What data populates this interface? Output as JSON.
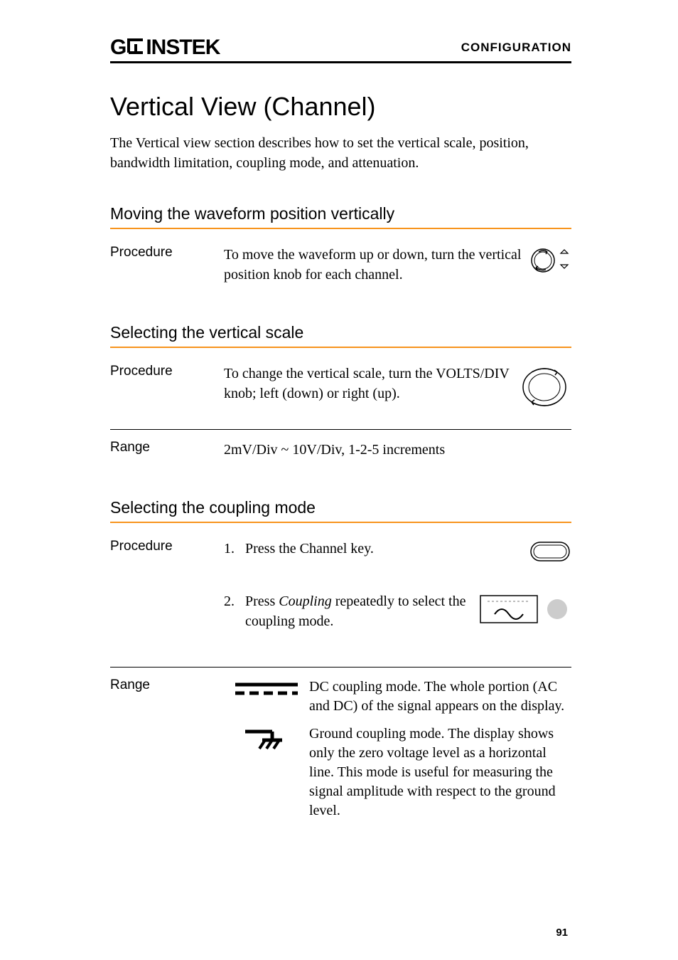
{
  "header": {
    "brand": "GWINSTEK",
    "section": "CONFIGURATION"
  },
  "title": "Vertical View (Channel)",
  "intro": "The Vertical view section describes how to set the vertical scale, position, bandwidth limitation, coupling mode, and attenuation.",
  "sections": {
    "moving": {
      "title": "Moving the waveform position vertically",
      "procedure_label": "Procedure",
      "procedure_text": "To move the waveform up or down, turn the vertical position knob for each channel."
    },
    "scale": {
      "title": "Selecting the vertical scale",
      "procedure_label": "Procedure",
      "procedure_text": "To change the vertical scale, turn the VOLTS/DIV knob; left (down) or right (up).",
      "range_label": "Range",
      "range_text": "2mV/Div ~ 10V/Div, 1-2-5 increments"
    },
    "coupling": {
      "title": "Selecting the coupling mode",
      "procedure_label": "Procedure",
      "step1": "Press the Channel key.",
      "step2_pre": "Press ",
      "step2_em": "Coupling",
      "step2_post": " repeatedly to select the coupling mode.",
      "range_label": "Range",
      "dc_desc": "DC coupling mode. The whole portion (AC and DC) of the signal appears on the display.",
      "gnd_desc": "Ground coupling mode. The display shows only the zero voltage level as a horizontal line. This mode is useful for measuring the signal amplitude with respect to the ground level."
    }
  },
  "page_number": "91"
}
